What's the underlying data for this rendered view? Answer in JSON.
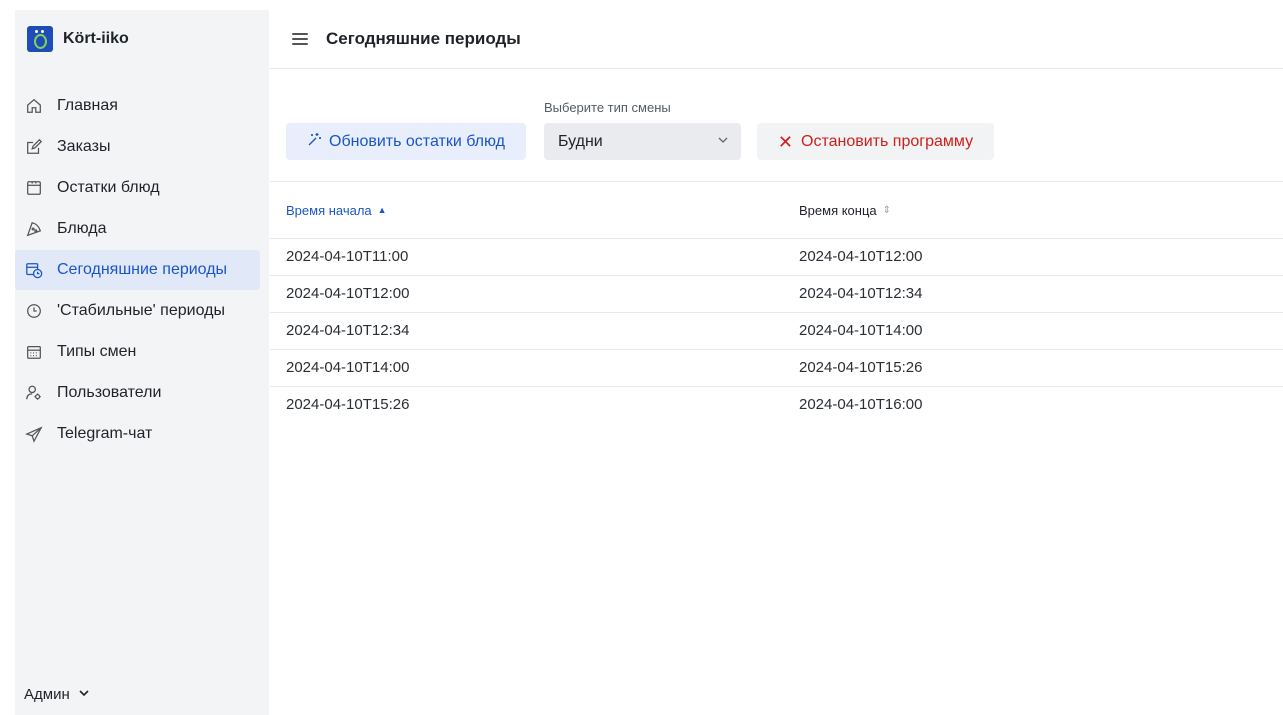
{
  "brand": {
    "title": "Kört-iiko"
  },
  "sidebar": {
    "items": [
      {
        "label": "Главная",
        "icon": "home-icon",
        "active": false
      },
      {
        "label": "Заказы",
        "icon": "edit-icon",
        "active": false
      },
      {
        "label": "Остатки блюд",
        "icon": "box-icon",
        "active": false
      },
      {
        "label": "Блюда",
        "icon": "pizza-icon",
        "active": false
      },
      {
        "label": "Сегодняшние периоды",
        "icon": "calendar-clock-icon",
        "active": true
      },
      {
        "label": "'Стабильные' периоды",
        "icon": "clock-icon",
        "active": false
      },
      {
        "label": "Типы смен",
        "icon": "calendar-icon",
        "active": false
      },
      {
        "label": "Пользователи",
        "icon": "user-settings-icon",
        "active": false
      },
      {
        "label": "Telegram-чат",
        "icon": "send-icon",
        "active": false
      }
    ],
    "user": "Админ"
  },
  "header": {
    "title": "Сегодняшние периоды"
  },
  "toolbar": {
    "refresh_label": "Обновить остатки блюд",
    "select_label": "Выберите тип смены",
    "select_value": "Будни",
    "stop_label": "Остановить программу"
  },
  "table": {
    "columns": [
      "Время начала",
      "Время конца"
    ],
    "rows": [
      [
        "2024-04-10T11:00",
        "2024-04-10T12:00"
      ],
      [
        "2024-04-10T12:00",
        "2024-04-10T12:34"
      ],
      [
        "2024-04-10T12:34",
        "2024-04-10T14:00"
      ],
      [
        "2024-04-10T14:00",
        "2024-04-10T15:26"
      ],
      [
        "2024-04-10T15:26",
        "2024-04-10T16:00"
      ]
    ]
  },
  "colors": {
    "accent": "#1a56c7",
    "danger": "#d0201b",
    "sidebar_bg": "#f3f4f6",
    "active_bg": "#e1e8f7"
  }
}
